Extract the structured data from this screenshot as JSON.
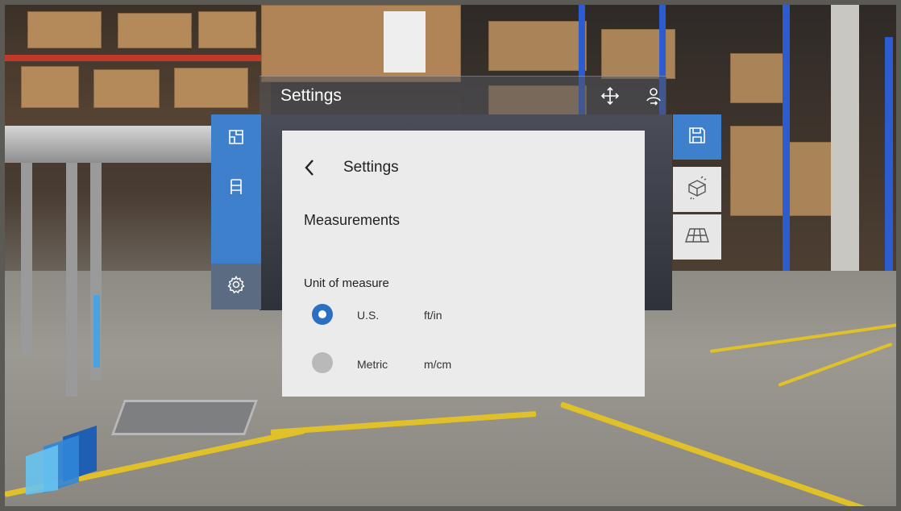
{
  "window": {
    "title": "Settings",
    "move_icon": "move-arrows-icon",
    "follow_icon": "person-follow-icon"
  },
  "left_rail": [
    {
      "icon": "floor-plan-icon",
      "active": false
    },
    {
      "icon": "shelf-icon",
      "active": false
    },
    {
      "icon": "gear-icon",
      "active": true
    }
  ],
  "right_rail": [
    {
      "icon": "save-icon",
      "style": "primary"
    },
    {
      "icon": "3d-object-icon",
      "style": "light"
    },
    {
      "icon": "floor-grid-icon",
      "style": "light"
    }
  ],
  "card": {
    "title": "Settings",
    "section": "Measurements",
    "unit_label": "Unit of measure",
    "options": [
      {
        "name": "U.S.",
        "unit": "ft/in",
        "selected": true
      },
      {
        "name": "Metric",
        "unit": "m/cm",
        "selected": false
      }
    ]
  },
  "colors": {
    "accent": "#3f80cc",
    "selected_radio": "#2b6fc2",
    "card_bg": "#ebebeb",
    "panel_bg": "#3b3e49"
  }
}
